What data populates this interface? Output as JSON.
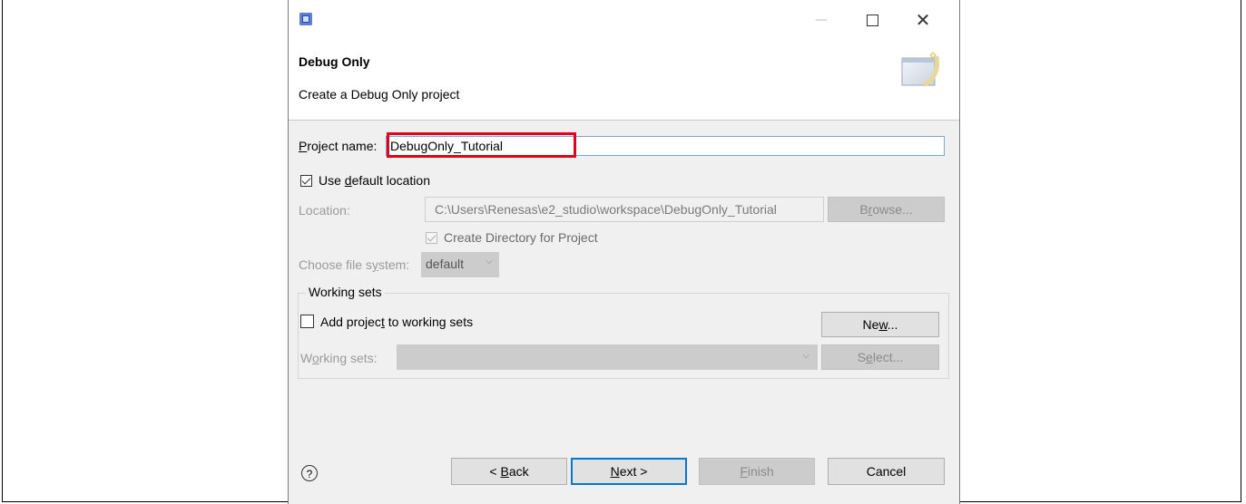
{
  "window": {
    "minimize_glyph": "—",
    "close_glyph": "✕"
  },
  "banner": {
    "title": "Debug Only",
    "description": "Create a Debug Only project"
  },
  "project": {
    "name_label_pre": "",
    "name_label_mnemonic": "P",
    "name_label_post": "roject name:",
    "name_value": "DebugOnly_Tutorial"
  },
  "default_location": {
    "pre": "Use ",
    "mnemonic": "d",
    "post": "efault location",
    "checked": true
  },
  "location": {
    "label": "Location:",
    "value": "C:\\Users\\Renesas\\e2_studio\\workspace\\DebugOnly_Tutorial",
    "browse_pre": "B",
    "browse_mnemonic": "r",
    "browse_post": "owse..."
  },
  "create_directory": {
    "label": "Create Directory for Project",
    "checked": true
  },
  "file_system": {
    "label_pre": "Choose file s",
    "label_mnemonic": "y",
    "label_post": "stem:",
    "selected": "default"
  },
  "working_sets": {
    "group_title": "Working sets",
    "add_pre": "Add projec",
    "add_mnemonic": "t",
    "add_post": " to working sets",
    "add_checked": false,
    "new_pre": "Ne",
    "new_mnemonic": "w",
    "new_post": "...",
    "sets_label_pre": "W",
    "sets_label_mnemonic": "o",
    "sets_label_post": "rking sets:",
    "select_pre": "S",
    "select_mnemonic": "e",
    "select_post": "lect..."
  },
  "footer": {
    "help_glyph": "?",
    "back_pre": "< ",
    "back_mnemonic": "B",
    "back_post": "ack",
    "next_mnemonic": "N",
    "next_post": "ext >",
    "finish_mnemonic": "F",
    "finish_post": "inish",
    "cancel": "Cancel"
  },
  "colors": {
    "highlight": "#e3001b",
    "dialog_bg": "#f0f0f0",
    "default_button_border": "#0078d7"
  }
}
